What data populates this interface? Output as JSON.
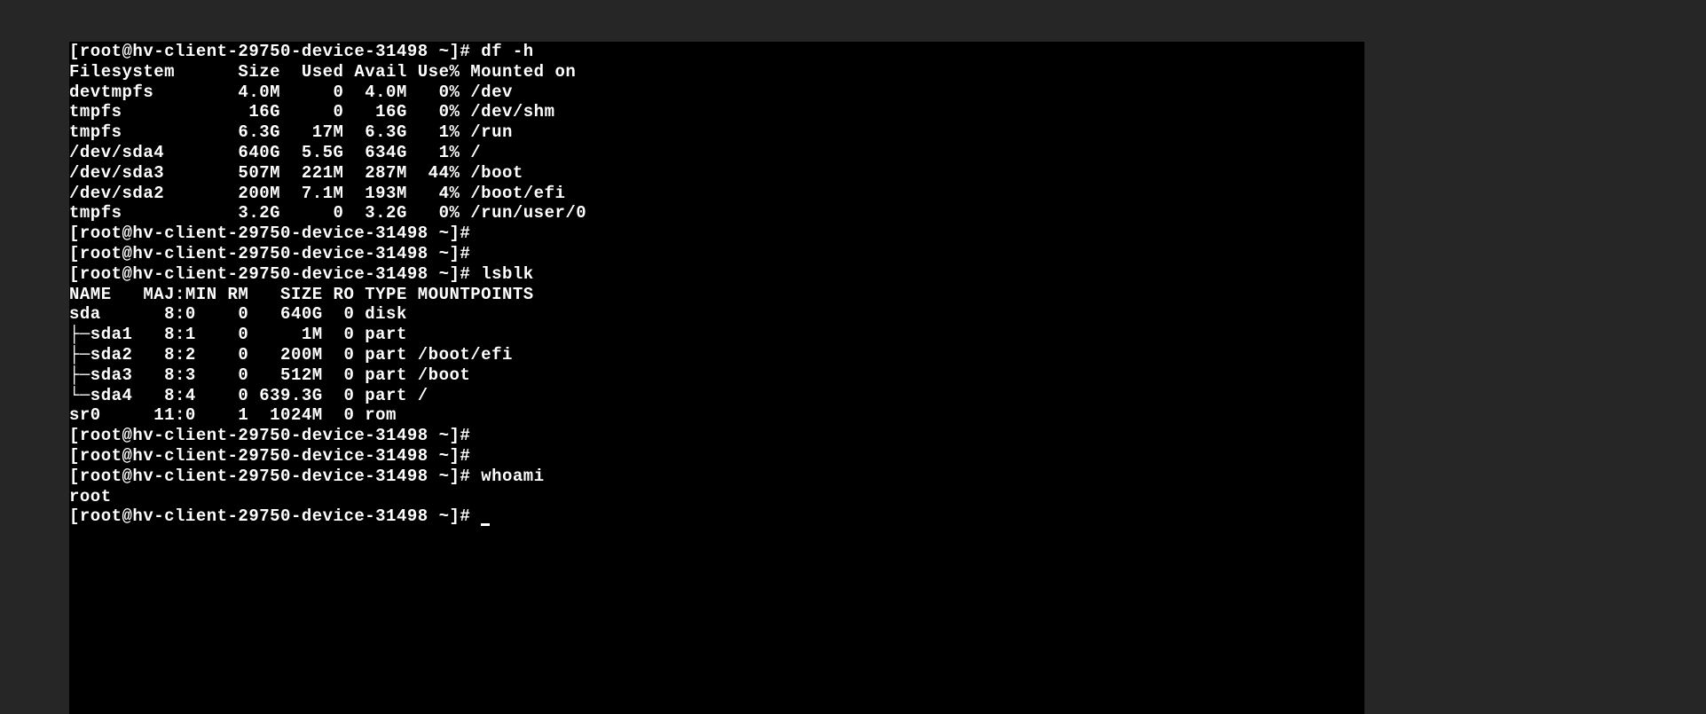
{
  "prompt_text": "[root@hv-client-29750-device-31498 ~]#",
  "commands": {
    "df": "df -h",
    "lsblk": "lsblk",
    "whoami": "whoami"
  },
  "df_header": "Filesystem      Size  Used Avail Use% Mounted on",
  "df_rows": [
    "devtmpfs        4.0M     0  4.0M   0% /dev",
    "tmpfs            16G     0   16G   0% /dev/shm",
    "tmpfs           6.3G   17M  6.3G   1% /run",
    "/dev/sda4       640G  5.5G  634G   1% /",
    "/dev/sda3       507M  221M  287M  44% /boot",
    "/dev/sda2       200M  7.1M  193M   4% /boot/efi",
    "tmpfs           3.2G     0  3.2G   0% /run/user/0"
  ],
  "lsblk_header": "NAME   MAJ:MIN RM   SIZE RO TYPE MOUNTPOINTS",
  "lsblk_rows": [
    "sda      8:0    0   640G  0 disk ",
    "├─sda1   8:1    0     1M  0 part ",
    "├─sda2   8:2    0   200M  0 part /boot/efi",
    "├─sda3   8:3    0   512M  0 part /boot",
    "└─sda4   8:4    0 639.3G  0 part /",
    "sr0     11:0    1  1024M  0 rom  "
  ],
  "whoami_output": "root"
}
